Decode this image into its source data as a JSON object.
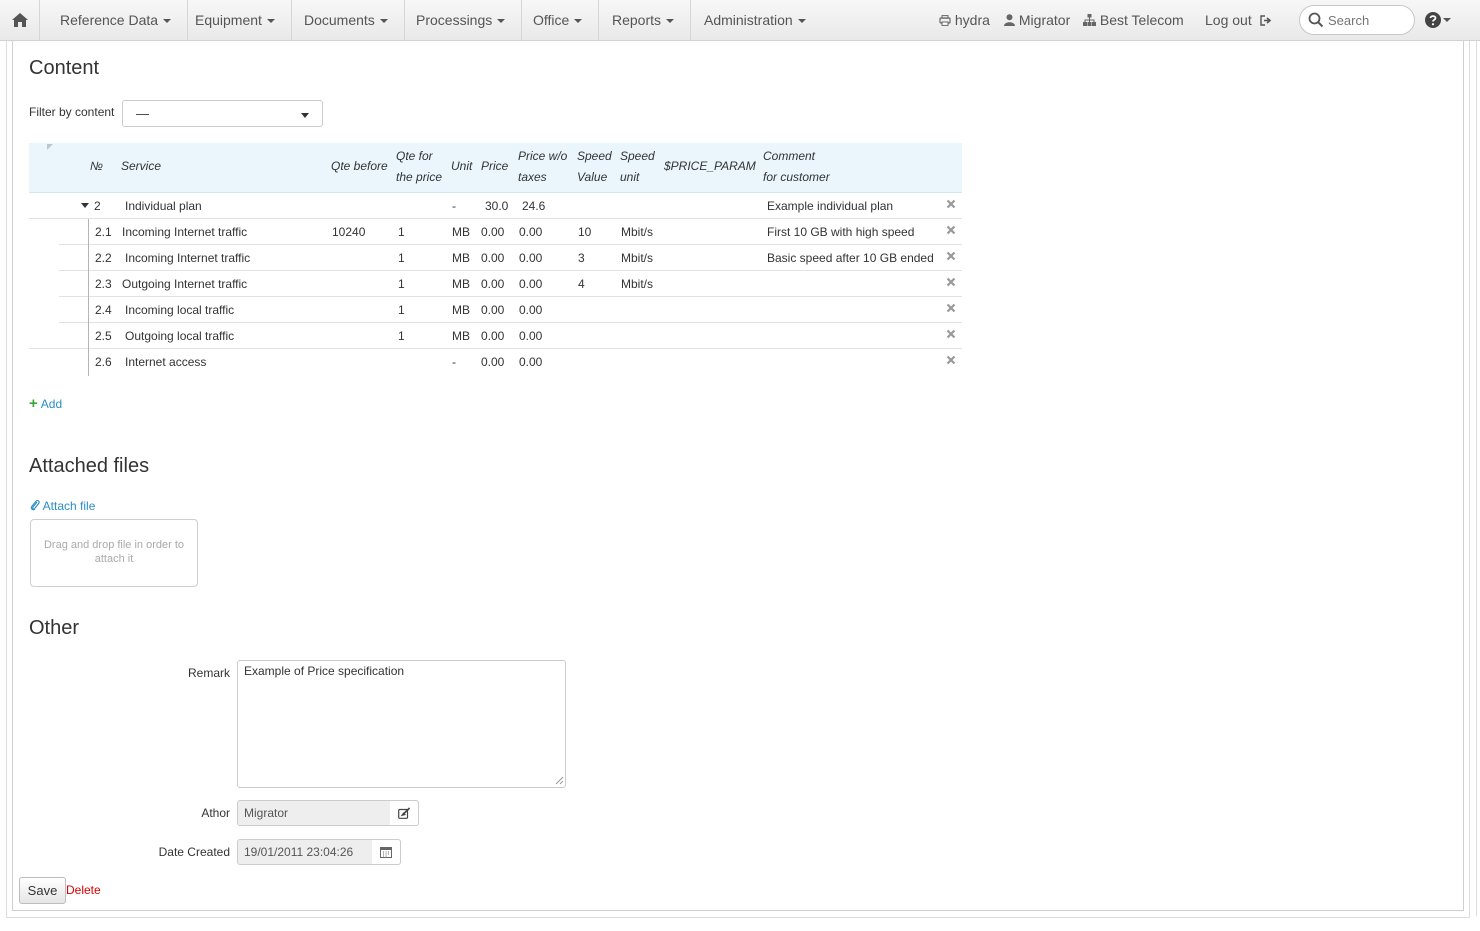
{
  "nav": {
    "menus": [
      {
        "label": "Reference Data"
      },
      {
        "label": "Equipment"
      },
      {
        "label": "Documents"
      },
      {
        "label": "Processings"
      },
      {
        "label": "Office"
      },
      {
        "label": "Reports"
      },
      {
        "label": "Administration"
      }
    ],
    "host": "hydra",
    "user": "Migrator",
    "company": "Best Telecom",
    "logout": "Log out",
    "search_placeholder": "Search"
  },
  "content": {
    "title": "Content",
    "filter_label": "Filter by content",
    "filter_value": "—",
    "columns": {
      "num": "№",
      "service": "Service",
      "qte_before": "Qte before",
      "qte_price_1": "Qte for",
      "qte_price_2": "the price",
      "unit": "Unit",
      "price": "Price",
      "price_wo_1": "Price w/o",
      "price_wo_2": "taxes",
      "speed_value_1": "Speed",
      "speed_value_2": "Value",
      "speed_unit_1": "Speed",
      "speed_unit_2": "unit",
      "price_param": "$PRICE_PARAM",
      "comment_1": "Comment",
      "comment_2": "for customer"
    },
    "rows": [
      {
        "num": "2",
        "service": "Individual plan",
        "qte_before": "",
        "qte_price": "",
        "unit": "-",
        "price": "30.0",
        "price_wo": "24.6",
        "speed_value": "",
        "speed_unit": "",
        "comment": "Example individual plan"
      },
      {
        "num": "2.1",
        "service": "Incoming Internet traffic",
        "qte_before": "10240",
        "qte_price": "1",
        "unit": "MB",
        "price": "0.00",
        "price_wo": "0.00",
        "speed_value": "10",
        "speed_unit": "Mbit/s",
        "comment": "First 10 GB with high speed"
      },
      {
        "num": "2.2",
        "service": "Incoming Internet traffic",
        "qte_before": "",
        "qte_price": "1",
        "unit": "MB",
        "price": "0.00",
        "price_wo": "0.00",
        "speed_value": "3",
        "speed_unit": "Mbit/s",
        "comment": "Basic speed after 10 GB ended"
      },
      {
        "num": "2.3",
        "service": "Outgoing Internet traffic",
        "qte_before": "",
        "qte_price": "1",
        "unit": "MB",
        "price": "0.00",
        "price_wo": "0.00",
        "speed_value": "4",
        "speed_unit": "Mbit/s",
        "comment": ""
      },
      {
        "num": "2.4",
        "service": "Incoming local traffic",
        "qte_before": "",
        "qte_price": "1",
        "unit": "MB",
        "price": "0.00",
        "price_wo": "0.00",
        "speed_value": "",
        "speed_unit": "",
        "comment": ""
      },
      {
        "num": "2.5",
        "service": "Outgoing local traffic",
        "qte_before": "",
        "qte_price": "1",
        "unit": "MB",
        "price": "0.00",
        "price_wo": "0.00",
        "speed_value": "",
        "speed_unit": "",
        "comment": ""
      },
      {
        "num": "2.6",
        "service": "Internet access",
        "qte_before": "",
        "qte_price": "",
        "unit": "-",
        "price": "0.00",
        "price_wo": "0.00",
        "speed_value": "",
        "speed_unit": "",
        "comment": ""
      }
    ],
    "add_label": "Add"
  },
  "files": {
    "title": "Attached files",
    "attach_label": "Attach file",
    "dropzone_text": "Drag and drop file in order to attach it"
  },
  "other": {
    "title": "Other",
    "remark_label": "Remark",
    "remark_value": "Example of Price specification",
    "author_label": "Athor",
    "author_value": "Migrator",
    "date_label": "Date Created",
    "date_value": "19/01/2011 23:04:26"
  },
  "actions": {
    "save": "Save",
    "delete": "Delete"
  },
  "colors": {
    "link": "#2a8ec5",
    "delete": "#d80000",
    "header_bg": "#eaf6fc",
    "add_plus": "#3aa636"
  }
}
